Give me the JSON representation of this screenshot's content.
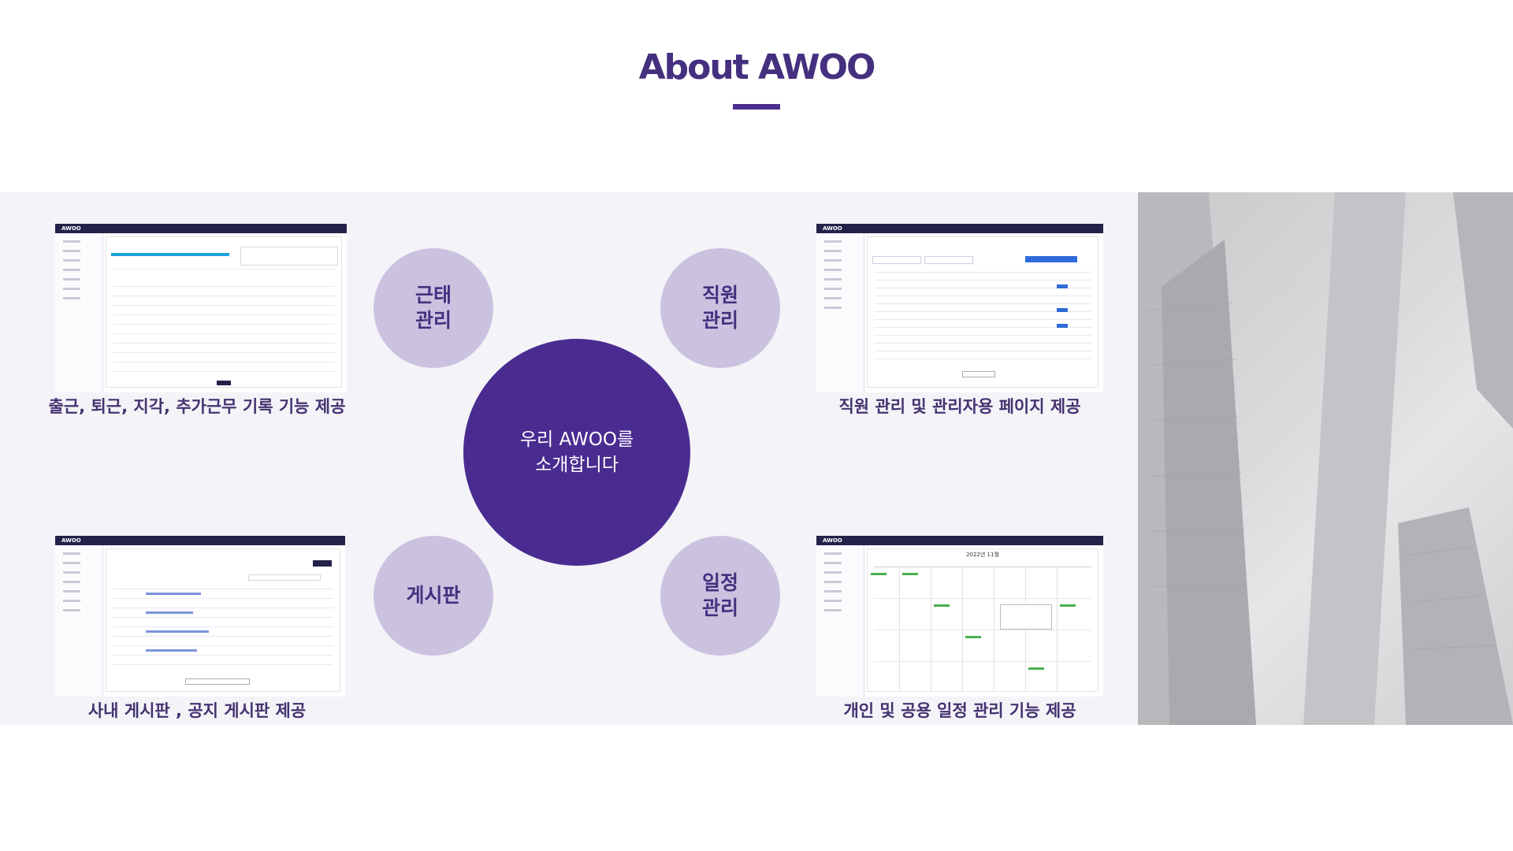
{
  "page": {
    "title": "About AWOO"
  },
  "center": {
    "line1": "우리 AWOO를",
    "line2": "소개합니다"
  },
  "features": {
    "attendance": {
      "line1": "근태",
      "line2": "관리",
      "caption": "출근, 퇴근, 지각, 추가근무 기록 기능 제공",
      "logo": "AWOO"
    },
    "employee": {
      "line1": "직원",
      "line2": "관리",
      "caption": "직원 관리 및 관리자용 페이지 제공",
      "logo": "AWOO"
    },
    "board": {
      "label": "게시판",
      "caption": "사내 게시판 , 공지 게시판 제공",
      "logo": "AWOO"
    },
    "schedule": {
      "line1": "일정",
      "line2": "관리",
      "caption": "개인 및 공용 일정 관리 기능 제공",
      "logo": "AWOO",
      "calendar_title": "2022년 11월"
    }
  },
  "colors": {
    "accent": "#4a2c91",
    "circle_light": "#cbc2e0",
    "band": "#f3f3f8",
    "title": "#45307f"
  }
}
